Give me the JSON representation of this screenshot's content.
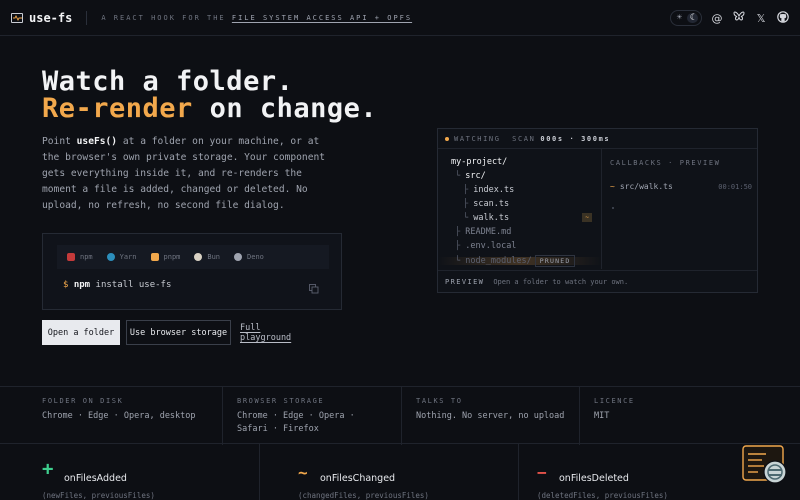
{
  "header": {
    "brand": "use-fs",
    "tagline_pre": "A REACT HOOK FOR THE ",
    "tagline_link": "FILE SYSTEM ACCESS API + OPFS",
    "theme_icons": [
      "sun-icon",
      "moon-icon"
    ],
    "social_icons": [
      "at-icon",
      "butterfly-icon",
      "x-icon",
      "github-icon"
    ]
  },
  "hero": {
    "line1": "Watch a folder.",
    "line2_accent": "Re-render",
    "line2_rest": " on change.",
    "desc_pre": "Point ",
    "desc_code": "useFs()",
    "desc_post": " at a folder on your machine, or at the browser's own private storage. Your component gets everything inside it, and re-renders the moment a file is added, changed or deleted. No upload, no refresh, no second file dialog."
  },
  "install": {
    "managers": [
      {
        "label": "npm",
        "color": "#c43a3a"
      },
      {
        "label": "Yarn",
        "color": "#2c8ebb"
      },
      {
        "label": "pnpm",
        "color": "#f2a84c"
      },
      {
        "label": "Bun",
        "color": "#d9d2c4"
      },
      {
        "label": "Deno",
        "color": "#9fa4b0"
      }
    ],
    "prompt": "$",
    "pkg": "npm",
    "cmd": " install use-fs"
  },
  "actions": {
    "open_folder": "Open a folder",
    "browser_storage": "Use browser storage",
    "playground": "Full playground"
  },
  "watcher": {
    "status": "WATCHING",
    "scan_label": "SCAN",
    "scan_value": "000s · 300ms",
    "tree": [
      {
        "name": "my-project/",
        "prefix": ""
      },
      {
        "name": "src/",
        "prefix": "└"
      },
      {
        "name": "index.ts",
        "prefix": "├"
      },
      {
        "name": "scan.ts",
        "prefix": "├"
      },
      {
        "name": "walk.ts",
        "prefix": "└"
      },
      {
        "name": "README.md",
        "prefix": "├"
      },
      {
        "name": ".env.local",
        "prefix": "├"
      },
      {
        "name": "node_modules/",
        "prefix": "└"
      }
    ],
    "pruned": "PRUNED",
    "callbacks_head": "CALLBACKS · PREVIEW",
    "event_symbol": "~",
    "event_path": "src/walk.ts",
    "event_time": "00:01:50",
    "footer_label": "PREVIEW",
    "footer_text": "Open a folder to watch your own."
  },
  "features": [
    {
      "label": "FOLDER ON DISK",
      "lines": [
        "Chrome · Edge · Opera, desktop"
      ]
    },
    {
      "label": "BROWSER STORAGE",
      "lines": [
        "Chrome · Edge · Opera ·",
        "Safari · Firefox"
      ]
    },
    {
      "label": "TALKS TO",
      "lines": [
        "Nothing. No server, no upload"
      ]
    },
    {
      "label": "LICENCE",
      "lines": [
        "MIT"
      ]
    }
  ],
  "callbacks": [
    {
      "symbol": "+",
      "color": "#3ecf8e",
      "name": "onFilesAdded",
      "sig": "(newFiles, previousFiles)"
    },
    {
      "symbol": "~",
      "color": "#f2a84c",
      "name": "onFilesChanged",
      "sig": "(changedFiles, previousFiles)"
    },
    {
      "symbol": "−",
      "color": "#e5534b",
      "name": "onFilesDeleted",
      "sig": "(deletedFiles, previousFiles)"
    }
  ]
}
